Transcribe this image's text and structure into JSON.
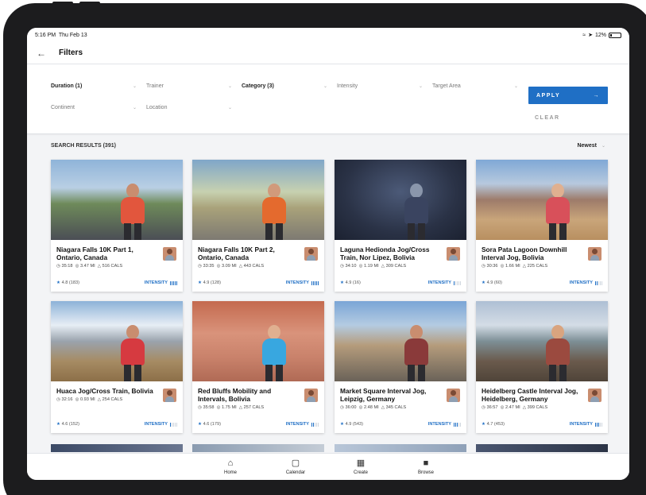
{
  "status": {
    "time": "5:16 PM",
    "date": "Thu Feb 13",
    "battery": "12%"
  },
  "header": {
    "title": "Filters"
  },
  "filters": [
    {
      "label": "Duration (1)",
      "bold": true
    },
    {
      "label": "Trainer",
      "bold": false
    },
    {
      "label": "Category (3)",
      "bold": true
    },
    {
      "label": "Intensity",
      "bold": false
    },
    {
      "label": "Target Area",
      "bold": false
    },
    {
      "label": "Continent",
      "bold": false
    },
    {
      "label": "Location",
      "bold": false
    }
  ],
  "actions": {
    "apply": "APPLY",
    "clear": "CLEAR"
  },
  "results": {
    "label": "SEARCH RESULTS (391)",
    "sort": "Newest"
  },
  "intensity_label": "INTENSITY",
  "colors": {
    "accent": "#1f6fc5"
  },
  "cards": [
    {
      "title": "Niagara Falls 10K Part 1, Ontario, Canada",
      "time": "35:18",
      "distance": "3.47 MI",
      "cals": "516 CALS",
      "rating": "4.8",
      "reviews": "(183)",
      "intensity": 5
    },
    {
      "title": "Niagara Falls 10K Part 2, Ontario, Canada",
      "time": "33:35",
      "distance": "3.09 MI",
      "cals": "443 CALS",
      "rating": "4.9",
      "reviews": "(128)",
      "intensity": 5
    },
    {
      "title": "Laguna Hedionda Jog/Cross Train, Nor Lipez, Bolivia",
      "time": "34:10",
      "distance": "1.19 MI",
      "cals": "309 CALS",
      "rating": "4.9",
      "reviews": "(16)",
      "intensity": 1
    },
    {
      "title": "Sora Pata Lagoon Downhill Interval Jog, Bolivia",
      "time": "30:36",
      "distance": "1.66 MI",
      "cals": "225 CALS",
      "rating": "4.9",
      "reviews": "(60)",
      "intensity": 2
    },
    {
      "title": "Huaca Jog/Cross Train, Bolivia",
      "time": "32:16",
      "distance": "0.93 MI",
      "cals": "254 CALS",
      "rating": "4.6",
      "reviews": "(152)",
      "intensity": 1
    },
    {
      "title": "Red Bluffs Mobility and Intervals, Bolivia",
      "time": "35:58",
      "distance": "1.75 MI",
      "cals": "257 CALS",
      "rating": "4.6",
      "reviews": "(179)",
      "intensity": 2
    },
    {
      "title": "Market Square Interval Jog, Leipzig, Germany",
      "time": "36:00",
      "distance": "2.48 MI",
      "cals": "345 CALS",
      "rating": "4.9",
      "reviews": "(543)",
      "intensity": 3
    },
    {
      "title": "Heidelberg Castle Interval Jog, Heidelberg, Germany",
      "time": "36:57",
      "distance": "2.47 MI",
      "cals": "399 CALS",
      "rating": "4.7",
      "reviews": "(453)",
      "intensity": 3
    }
  ],
  "tabs": [
    {
      "label": "Home",
      "icon": "home-icon"
    },
    {
      "label": "Calendar",
      "icon": "calendar-icon"
    },
    {
      "label": "Create",
      "icon": "map-icon"
    },
    {
      "label": "Browse",
      "icon": "browse-icon"
    }
  ]
}
